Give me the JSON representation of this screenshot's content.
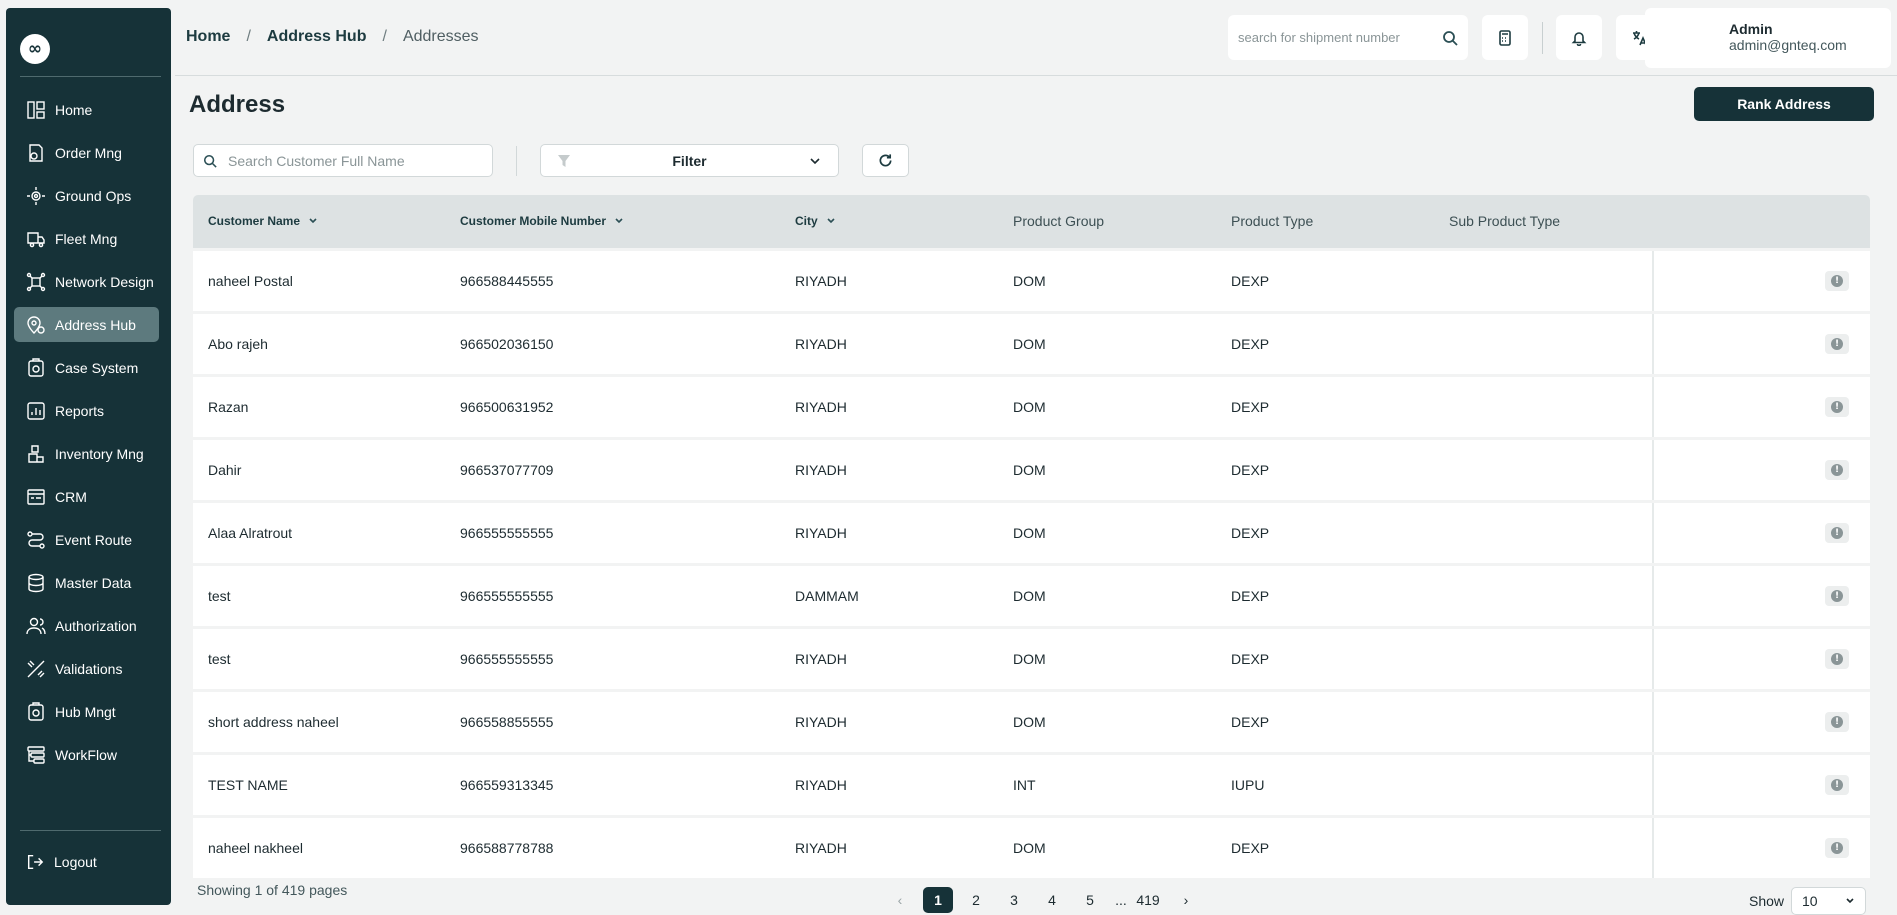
{
  "logo_glyph": "∞",
  "sidebar": {
    "items": [
      {
        "label": "Home",
        "icon": "home-icon",
        "active": false
      },
      {
        "label": "Order Mng",
        "icon": "order-icon",
        "active": false
      },
      {
        "label": "Ground Ops",
        "icon": "ground-ops-icon",
        "active": false
      },
      {
        "label": "Fleet Mng",
        "icon": "truck-icon",
        "active": false
      },
      {
        "label": "Network Design",
        "icon": "network-icon",
        "active": false
      },
      {
        "label": "Address Hub",
        "icon": "location-icon",
        "active": true
      },
      {
        "label": "Case System",
        "icon": "case-icon",
        "active": false
      },
      {
        "label": "Reports",
        "icon": "reports-icon",
        "active": false
      },
      {
        "label": "Inventory Mng",
        "icon": "inventory-icon",
        "active": false
      },
      {
        "label": "CRM",
        "icon": "crm-icon",
        "active": false
      },
      {
        "label": "Event Route",
        "icon": "route-icon",
        "active": false
      },
      {
        "label": "Master Data",
        "icon": "database-icon",
        "active": false
      },
      {
        "label": "Authorization",
        "icon": "users-icon",
        "active": false
      },
      {
        "label": "Validations",
        "icon": "validation-icon",
        "active": false
      },
      {
        "label": "Hub Mngt",
        "icon": "hub-icon",
        "active": false
      },
      {
        "label": "WorkFlow",
        "icon": "workflow-icon",
        "active": false
      }
    ],
    "logout_label": "Logout"
  },
  "header": {
    "breadcrumb": [
      "Home",
      "Address Hub",
      "Addresses"
    ],
    "breadcrumb_separator": "/",
    "search_placeholder": "search for shipment number",
    "user": {
      "name": "Admin",
      "email": "admin@gnteq.com"
    }
  },
  "page": {
    "title": "Address",
    "rank_button": "Rank Address",
    "customer_search_placeholder": "Search Customer Full Name",
    "filter_label": "Filter"
  },
  "table": {
    "columns": [
      "Customer Name",
      "Customer Mobile Number",
      "City",
      "Product Group",
      "Product Type",
      "Sub Product Type"
    ],
    "rows": [
      {
        "name": "naheel Postal",
        "mobile": "966588445555",
        "city": "RIYADH",
        "group": "DOM",
        "type": "DEXP",
        "sub": ""
      },
      {
        "name": "Abo rajeh",
        "mobile": "966502036150",
        "city": "RIYADH",
        "group": "DOM",
        "type": "DEXP",
        "sub": ""
      },
      {
        "name": "Razan",
        "mobile": "966500631952",
        "city": "RIYADH",
        "group": "DOM",
        "type": "DEXP",
        "sub": ""
      },
      {
        "name": "Dahir",
        "mobile": "966537077709",
        "city": "RIYADH",
        "group": "DOM",
        "type": "DEXP",
        "sub": ""
      },
      {
        "name": "Alaa Alratrout",
        "mobile": "966555555555",
        "city": "RIYADH",
        "group": "DOM",
        "type": "DEXP",
        "sub": ""
      },
      {
        "name": "test",
        "mobile": "966555555555",
        "city": "DAMMAM",
        "group": "DOM",
        "type": "DEXP",
        "sub": ""
      },
      {
        "name": "test",
        "mobile": "966555555555",
        "city": "RIYADH",
        "group": "DOM",
        "type": "DEXP",
        "sub": ""
      },
      {
        "name": "short address naheel",
        "mobile": "966558855555",
        "city": "RIYADH",
        "group": "DOM",
        "type": "DEXP",
        "sub": ""
      },
      {
        "name": "TEST NAME",
        "mobile": "966559313345",
        "city": "RIYADH",
        "group": "INT",
        "type": "IUPU",
        "sub": ""
      },
      {
        "name": "naheel nakheel",
        "mobile": "966588778788",
        "city": "RIYADH",
        "group": "DOM",
        "type": "DEXP",
        "sub": ""
      }
    ],
    "row_action_glyph": "!"
  },
  "footer": {
    "showing_text": "Showing 1 of 419 pages",
    "pages": [
      "1",
      "2",
      "3",
      "4",
      "5"
    ],
    "ellipsis": "...",
    "last_page": "419",
    "current_page": "1",
    "prev_glyph": "‹",
    "next_glyph": "›",
    "show_label": "Show",
    "page_size": "10"
  },
  "colors": {
    "sidebar_bg": "#163238",
    "active_item_bg": "#5d7a7e",
    "primary_button": "#163238",
    "table_header_bg": "#dde2e3",
    "page_bg": "#f2f3f3"
  }
}
